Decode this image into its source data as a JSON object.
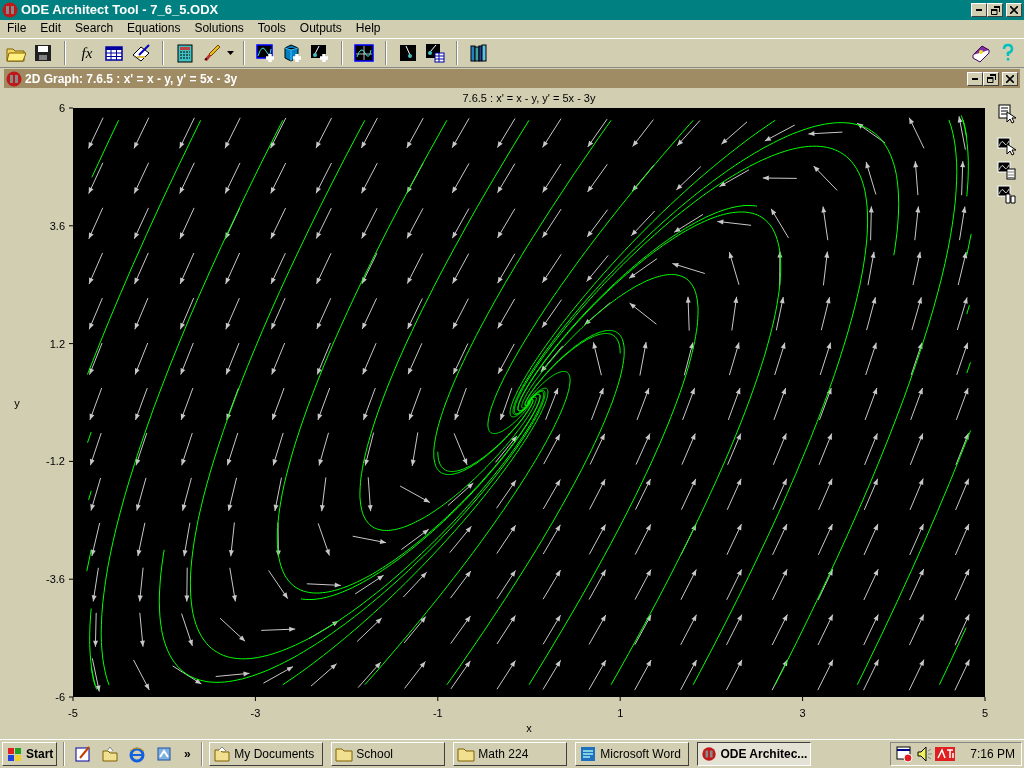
{
  "window": {
    "title": "ODE Architect Tool - 7_6_5.ODX"
  },
  "menu": [
    "File",
    "Edit",
    "Search",
    "Equations",
    "Solutions",
    "Tools",
    "Outputs",
    "Help"
  ],
  "toolbar": {
    "fx_label": "fx"
  },
  "graph_window": {
    "title": "2D Graph: 7.6.5 :  x' = x - y,   y' = 5x - 3y",
    "plot": {
      "title": "7.6.5 :  x' = x - y,   y' = 5x - 3y",
      "xlabel": "x",
      "ylabel": "y",
      "xticks": [
        "-5",
        "-3",
        "-1",
        "1",
        "3",
        "5"
      ],
      "yticks": [
        "6",
        "3.6",
        "1.2",
        "-1.2",
        "-3.6",
        "-6"
      ]
    }
  },
  "taskbar": {
    "start": "Start",
    "more": "»",
    "tasks": [
      {
        "label": "My Documents",
        "kind": "folder-open",
        "selected": false
      },
      {
        "label": "School",
        "kind": "folder",
        "selected": false
      },
      {
        "label": "Math 224",
        "kind": "folder",
        "selected": false
      },
      {
        "label": "Microsoft Word",
        "kind": "word",
        "selected": false
      },
      {
        "label": "ODE Architec...",
        "kind": "app",
        "selected": true
      }
    ],
    "clock": "7:16 PM"
  }
}
